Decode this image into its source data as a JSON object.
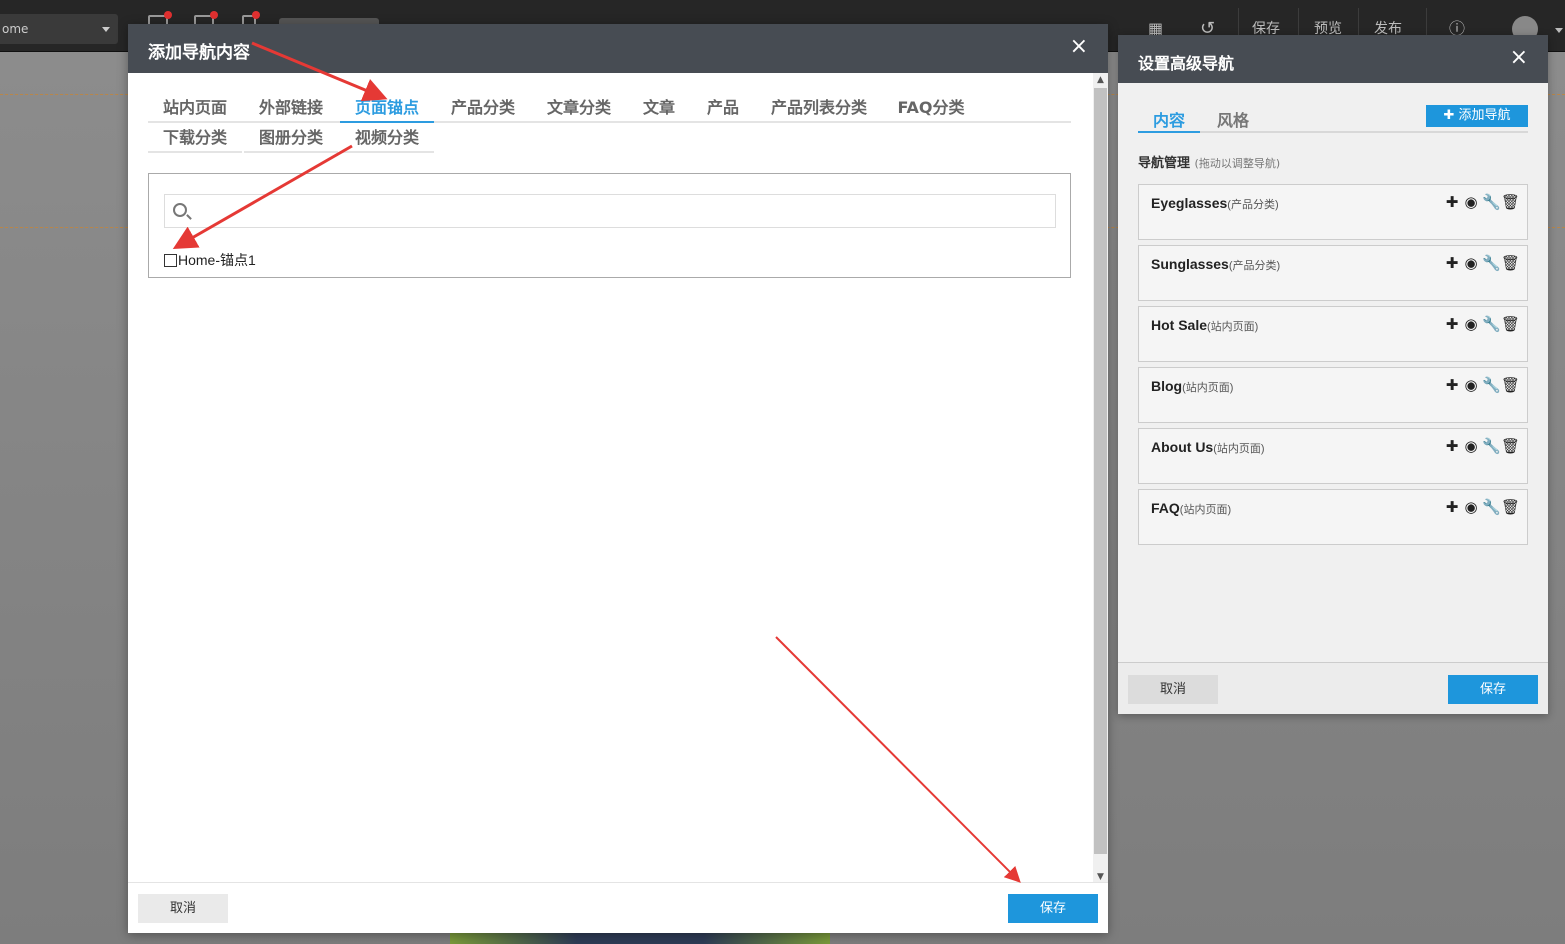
{
  "topbar": {
    "page_select": "ome",
    "save": "保存",
    "preview": "预览",
    "publish": "发布"
  },
  "modal": {
    "title": "添加导航内容",
    "close": "×",
    "tabs": [
      "站内页面",
      "外部链接",
      "页面锚点",
      "产品分类",
      "文章分类",
      "文章",
      "产品",
      "产品列表分类",
      "FAQ分类",
      "下载分类",
      "图册分类",
      "视频分类"
    ],
    "active_tab": "页面锚点",
    "search_placeholder": "",
    "anchors": [
      "Home-锚点1"
    ],
    "cancel": "取消",
    "save": "保存"
  },
  "side": {
    "title": "设置高级导航",
    "close": "×",
    "tabs": [
      "内容",
      "风格"
    ],
    "add_nav": "添加导航",
    "nav_mgmt": "导航管理",
    "nav_mgmt_hint": "(拖动以调整导航)",
    "items": [
      {
        "name": "Eyeglasses",
        "type": "(产品分类)"
      },
      {
        "name": "Sunglasses",
        "type": "(产品分类)"
      },
      {
        "name": "Hot Sale",
        "type": "(站内页面)"
      },
      {
        "name": "Blog",
        "type": "(站内页面)"
      },
      {
        "name": "About Us",
        "type": "(站内页面)"
      },
      {
        "name": "FAQ",
        "type": "(站内页面)"
      }
    ],
    "cancel": "取消",
    "save": "保存"
  },
  "colors": {
    "accent": "#1e96dc",
    "header": "#474c53",
    "annotation": "#e53935"
  }
}
